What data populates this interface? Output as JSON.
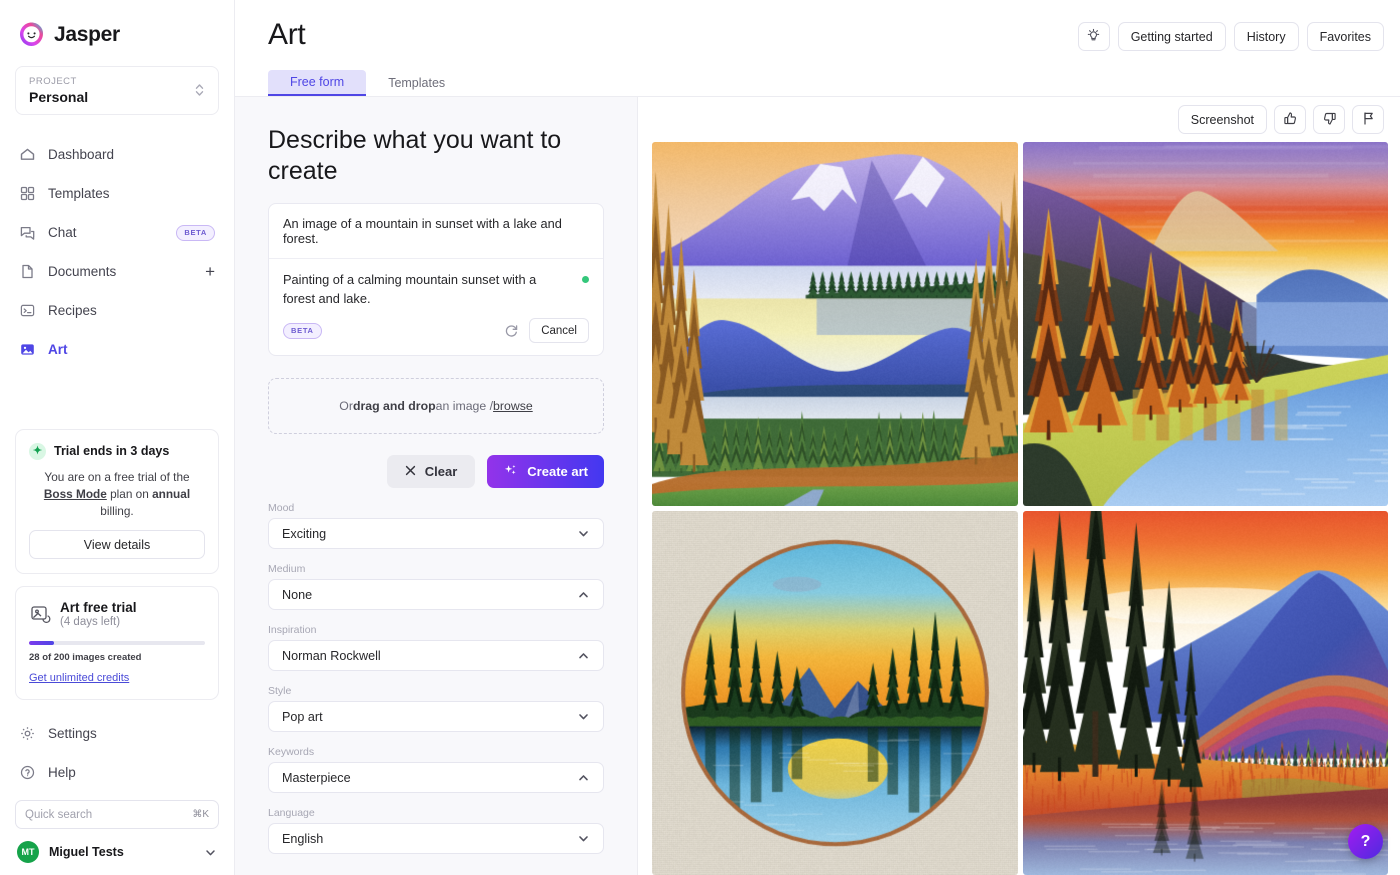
{
  "brand": {
    "name": "Jasper",
    "logo_icon": "jasper-smile-logo"
  },
  "sidebar": {
    "project": {
      "label": "PROJECT",
      "value": "Personal"
    },
    "nav": [
      {
        "label": "Dashboard",
        "icon": "home-icon"
      },
      {
        "label": "Templates",
        "icon": "grid-icon"
      },
      {
        "label": "Chat",
        "icon": "chat-bubble-icon",
        "badge": "BETA"
      },
      {
        "label": "Documents",
        "icon": "document-icon",
        "action": "+"
      },
      {
        "label": "Recipes",
        "icon": "terminal-icon"
      },
      {
        "label": "Art",
        "icon": "image-icon",
        "active": true
      }
    ],
    "trial": {
      "title": "Trial ends in 3 days",
      "desc_1": "You are on a free trial of the ",
      "desc_plan": "Boss Mode",
      "desc_2": " plan on ",
      "desc_billing": "annual",
      "desc_3": " billing.",
      "button": "View details"
    },
    "art_trial": {
      "title": "Art free trial",
      "subtitle": "(4 days left)",
      "progress_text": "28 of 200 images created",
      "progress_percent": 14,
      "link": "Get unlimited credits"
    },
    "bottom": [
      {
        "label": "Settings",
        "icon": "gear-icon"
      },
      {
        "label": "Help",
        "icon": "question-circle-icon"
      }
    ],
    "search": {
      "placeholder": "Quick search",
      "shortcut": "⌘K"
    },
    "user": {
      "initials": "MT",
      "name": "Miguel Tests"
    }
  },
  "header": {
    "title": "Art",
    "tabs": [
      {
        "label": "Free form",
        "active": true
      },
      {
        "label": "Templates",
        "active": false
      }
    ],
    "actions": [
      {
        "label": "",
        "icon": "lightbulb-icon",
        "icon_only": true
      },
      {
        "label": "Getting started",
        "icon": ""
      },
      {
        "label": "History",
        "icon": ""
      },
      {
        "label": "Favorites",
        "icon": ""
      }
    ]
  },
  "form": {
    "heading": "Describe what you want to create",
    "prompt_value": "An image of a mountain in sunset with a lake and forest.",
    "suggestion": "Painting of a calming mountain sunset with a forest and lake.",
    "suggestion_badge": "BETA",
    "cancel_label": "Cancel",
    "refresh_icon": "refresh-icon",
    "dropzone": {
      "prefix": "Or ",
      "strong": "drag and drop",
      "middle": " an image / ",
      "link": "browse"
    },
    "clear_label": "Clear",
    "create_label": "Create art",
    "fields": [
      {
        "label": "Mood",
        "value": "Exciting",
        "chevron": "down"
      },
      {
        "label": "Medium",
        "value": "None",
        "chevron": "up"
      },
      {
        "label": "Inspiration",
        "value": "Norman Rockwell",
        "chevron": "up"
      },
      {
        "label": "Style",
        "value": "Pop art",
        "chevron": "down"
      },
      {
        "label": "Keywords",
        "value": "Masterpiece",
        "chevron": "up"
      },
      {
        "label": "Language",
        "value": "English",
        "chevron": "down"
      }
    ]
  },
  "results": {
    "toolbar": [
      {
        "label": "Screenshot",
        "icon": ""
      },
      {
        "label": "",
        "icon": "thumbs-up-icon"
      },
      {
        "label": "",
        "icon": "thumbs-down-icon"
      },
      {
        "label": "",
        "icon": "flag-icon"
      }
    ],
    "images": [
      {
        "name": "mountain-lake-forest-painting",
        "variant": "a"
      },
      {
        "name": "autumn-trees-lake-watercolor",
        "variant": "b"
      },
      {
        "name": "circular-sunset-lake-painting",
        "variant": "c"
      },
      {
        "name": "sunset-pines-mountain-painting",
        "variant": "d"
      }
    ]
  },
  "fab": {
    "label": "?"
  },
  "colors": {
    "accent": "#4f46e5",
    "create_gradient_start": "#9333ea",
    "create_gradient_end": "#4338f0",
    "tab_active_bg": "#e2e0fb",
    "green_dot": "#34c77b",
    "avatar_bg": "#16a34a"
  }
}
